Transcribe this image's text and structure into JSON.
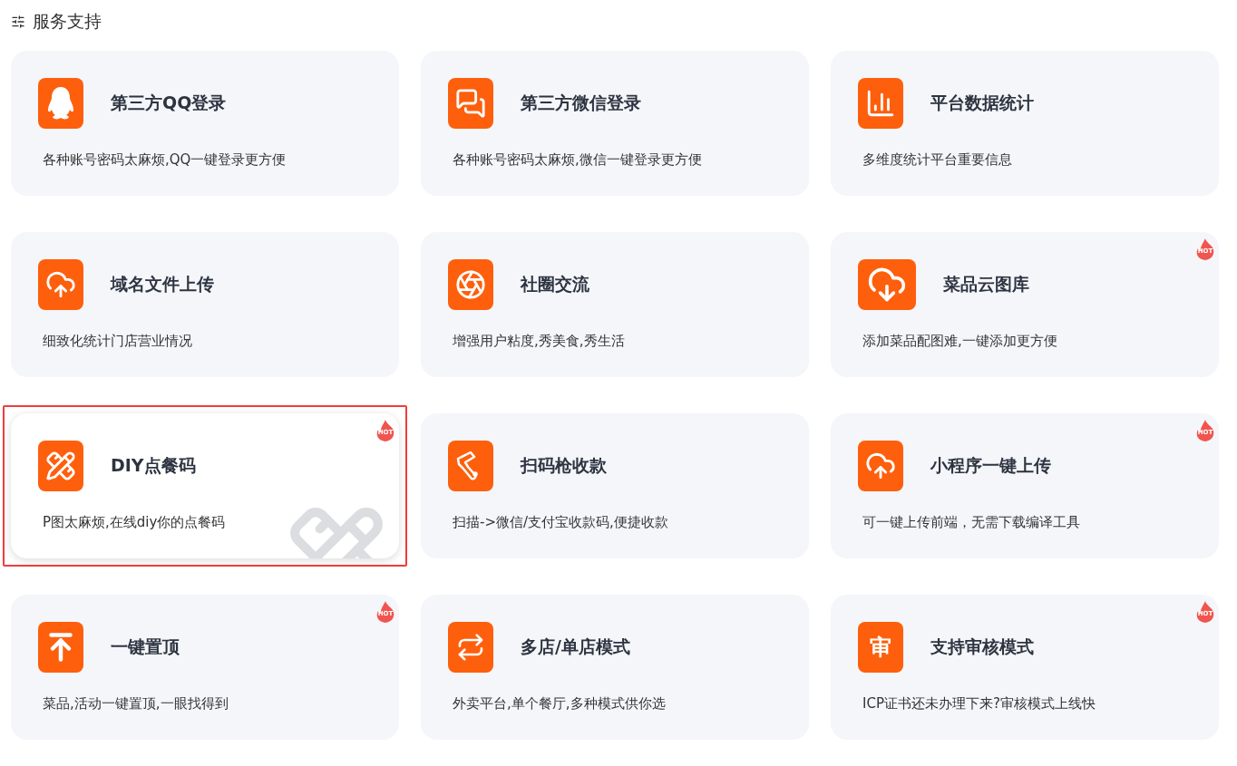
{
  "header": {
    "title": "服务支持"
  },
  "cards": [
    {
      "title": "第三方QQ登录",
      "description": "各种账号密码太麻烦,QQ一键登录更方便",
      "highlighted": false
    },
    {
      "title": "第三方微信登录",
      "description": "各种账号密码太麻烦,微信一键登录更方便",
      "highlighted": false
    },
    {
      "title": "平台数据统计",
      "description": "多维度统计平台重要信息",
      "highlighted": false
    },
    {
      "title": "域名文件上传",
      "description": "细致化统计门店营业情况",
      "highlighted": false
    },
    {
      "title": "社圈交流",
      "description": "增强用户粘度,秀美食,秀生活",
      "highlighted": false
    },
    {
      "title": "菜品云图库",
      "description": "添加菜品配图难,一键添加更方便",
      "badge": "HOT",
      "highlighted": false
    },
    {
      "title": "DIY点餐码",
      "description": "P图太麻烦,在线diy你的点餐码",
      "badge": "HOT",
      "highlighted": true
    },
    {
      "title": "扫码枪收款",
      "description": "扫描->微信/支付宝收款码,便捷收款",
      "highlighted": false
    },
    {
      "title": "小程序一键上传",
      "description": "可一键上传前端，无需下载编译工具",
      "badge": "HOT",
      "highlighted": false
    },
    {
      "title": "一键置顶",
      "description": "菜品,活动一键置顶,一眼找得到",
      "badge": "HOT",
      "highlighted": false
    },
    {
      "title": "多店/单店模式",
      "description": "外卖平台,单个餐厅,多种模式供你选",
      "highlighted": false
    },
    {
      "icon_text": "审",
      "title": "支持审核模式",
      "description": "ICP证书还未办理下来?审核模式上线快",
      "badge": "HOT",
      "highlighted": false
    }
  ]
}
